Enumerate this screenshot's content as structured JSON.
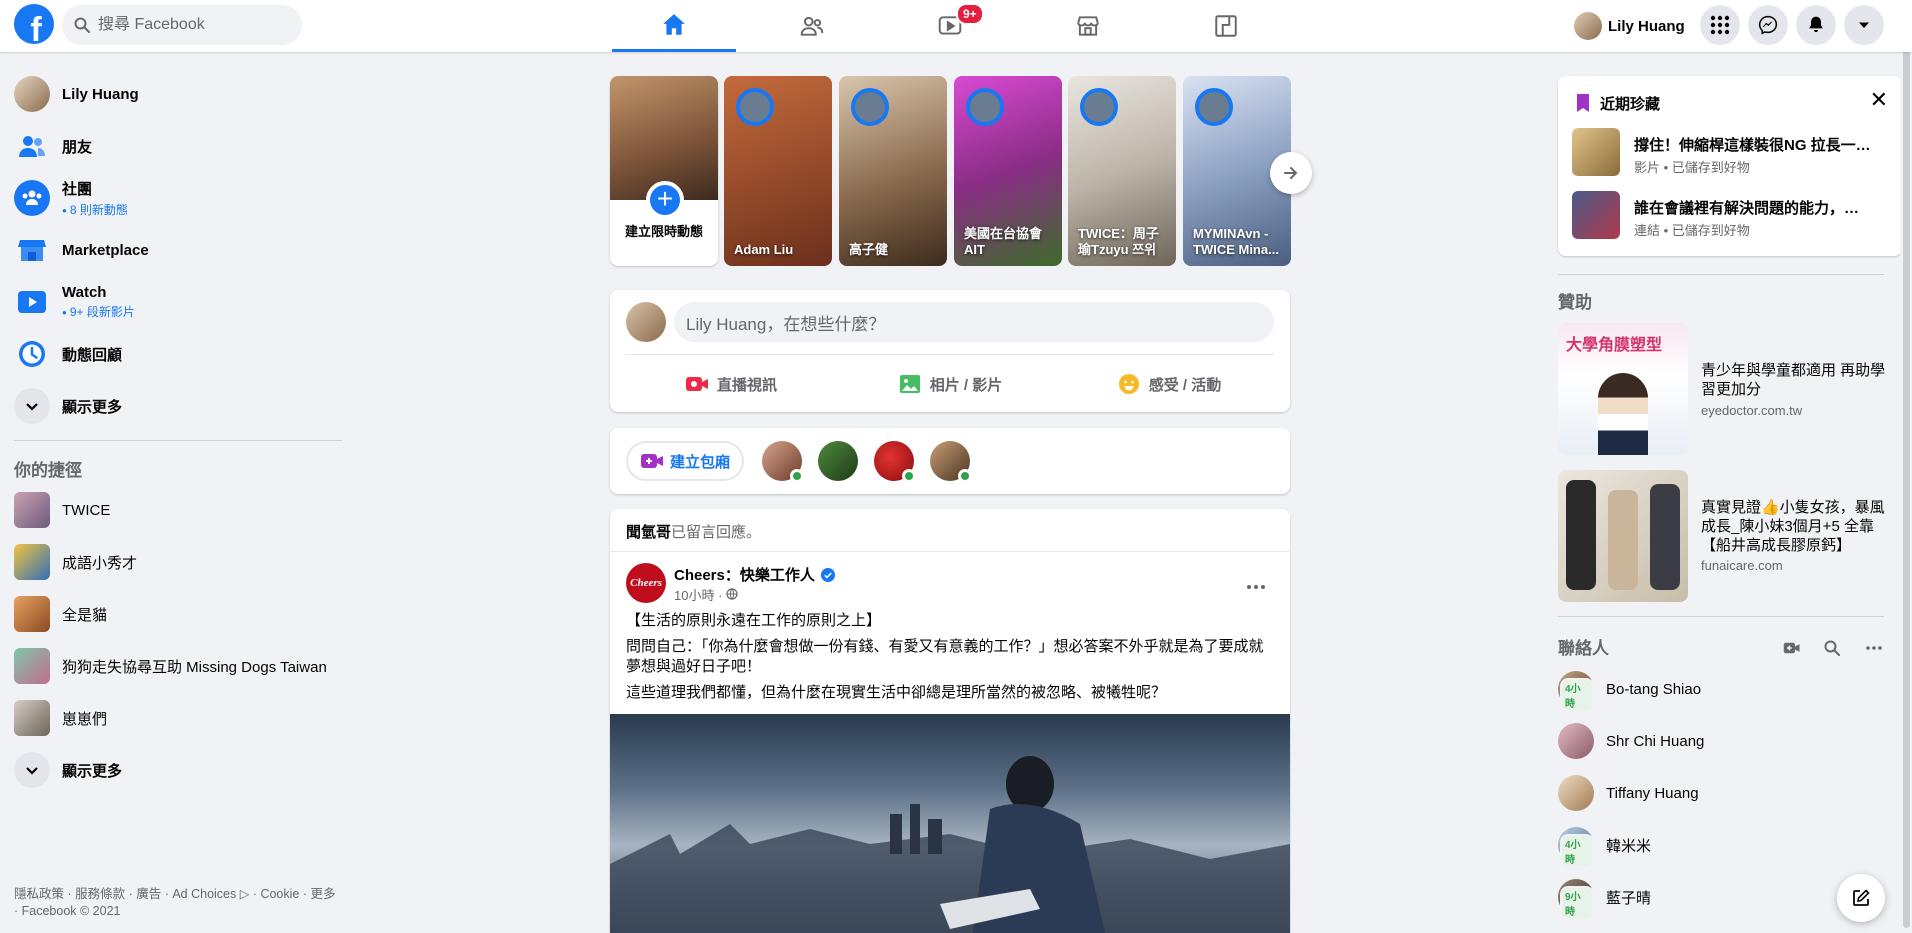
{
  "topbar": {
    "logo_letter": "f",
    "search_placeholder": "搜尋 Facebook",
    "tabs": [
      {
        "id": "home",
        "icon": "home-icon",
        "active": true
      },
      {
        "id": "friends",
        "icon": "friends-icon",
        "active": false
      },
      {
        "id": "watch",
        "icon": "watch-icon",
        "active": false,
        "badge": "9+"
      },
      {
        "id": "marketplace",
        "icon": "marketplace-icon",
        "active": false
      },
      {
        "id": "gaming",
        "icon": "gaming-icon",
        "active": false
      }
    ],
    "user_name": "Lily Huang",
    "accent": "#1877f2"
  },
  "sidebar": {
    "items": [
      {
        "label": "Lily Huang",
        "icon": "profile-avatar"
      },
      {
        "label": "朋友",
        "icon": "friends-icon"
      },
      {
        "label": "社團",
        "sub": "8 則新動態",
        "icon": "groups-icon"
      },
      {
        "label": "Marketplace",
        "icon": "marketplace-icon"
      },
      {
        "label": "Watch",
        "sub": "9+ 段新影片",
        "icon": "watch-icon"
      },
      {
        "label": "動態回顧",
        "icon": "memories-icon"
      },
      {
        "label": "顯示更多",
        "icon": "chevron-down-icon"
      }
    ],
    "shortcuts_title": "你的捷徑",
    "shortcuts": [
      {
        "label": "TWICE"
      },
      {
        "label": "成語小秀才"
      },
      {
        "label": "全是貓"
      },
      {
        "label": "狗狗走失協尋互助 Missing Dogs Taiwan"
      },
      {
        "label": "崽崽們"
      },
      {
        "label": "顯示更多"
      }
    ],
    "footer_line1": "隱私政策 · 服務條款 · 廣告 · Ad Choices ▷ · Cookie · 更多",
    "footer_line2": "· Facebook © 2021"
  },
  "stories": {
    "create_label": "建立限時動態",
    "items": [
      {
        "name": "Adam Liu",
        "color": "#b0573a"
      },
      {
        "name": "高子健",
        "color": "#8a6a4e"
      },
      {
        "name": "美國在台協會 AIT",
        "color": "#b83fb5"
      },
      {
        "name": "TWICE：周子瑜Tzuyu 쯔위",
        "color": "#c9c4bd"
      },
      {
        "name": "MYMINAvn - TWICE Mina...",
        "color": "#8ea2c4"
      }
    ]
  },
  "composer": {
    "placeholder": "Lily Huang，在想些什麼？",
    "actions": [
      {
        "label": "直播視訊",
        "icon": "live-video-icon"
      },
      {
        "label": "相片 / 影片",
        "icon": "photo-icon"
      },
      {
        "label": "感受 / 活動",
        "icon": "feeling-icon"
      }
    ]
  },
  "rooms": {
    "button_label": "建立包廂"
  },
  "post": {
    "reply_user": "聞氫哥",
    "reply_text": "已留言回應。",
    "page_name": "Cheers：快樂工作人",
    "avatar_text": "Cheers",
    "time": "10小時 · ",
    "paragraphs": [
      "【生活的原則永遠在工作的原則之上】",
      "問問自己：「你為什麼會想做一份有錢、有愛又有意義的工作？」想必答案不外乎就是為了要成就夢想與過好日子吧！",
      "這些道理我們都懂，但為什麼在現實生活中卻總是理所當然的被忽略、被犧牲呢？"
    ]
  },
  "saved": {
    "title": "近期珍藏",
    "items": [
      {
        "title": "撐住！伸縮桿這樣裝很NG 拉長一…",
        "meta": "影片 • 已儲存到好物"
      },
      {
        "title": "誰在會議裡有解決問題的能力，…",
        "meta": "連結 • 已儲存到好物"
      }
    ]
  },
  "sponsored": {
    "title": "贊助",
    "ads": [
      {
        "title": "青少年與學童都適用 再助學習更加分",
        "domain": "eyedoctor.com.tw",
        "image_text": "大學角膜塑型"
      },
      {
        "title": "真實見證👍小隻女孩，暴風成長_陳小妹3個月+5 全靠【船井高成長膠原鈣】",
        "domain": "funaicare.com"
      }
    ]
  },
  "contacts": {
    "title": "聯絡人",
    "items": [
      {
        "name": "Bo-tang Shiao",
        "badge": "4小時"
      },
      {
        "name": "Shr Chi Huang",
        "badge": ""
      },
      {
        "name": "Tiffany Huang",
        "badge": ""
      },
      {
        "name": "韓米米",
        "badge": "4小時"
      },
      {
        "name": "藍子晴",
        "badge": "9小時"
      }
    ]
  }
}
